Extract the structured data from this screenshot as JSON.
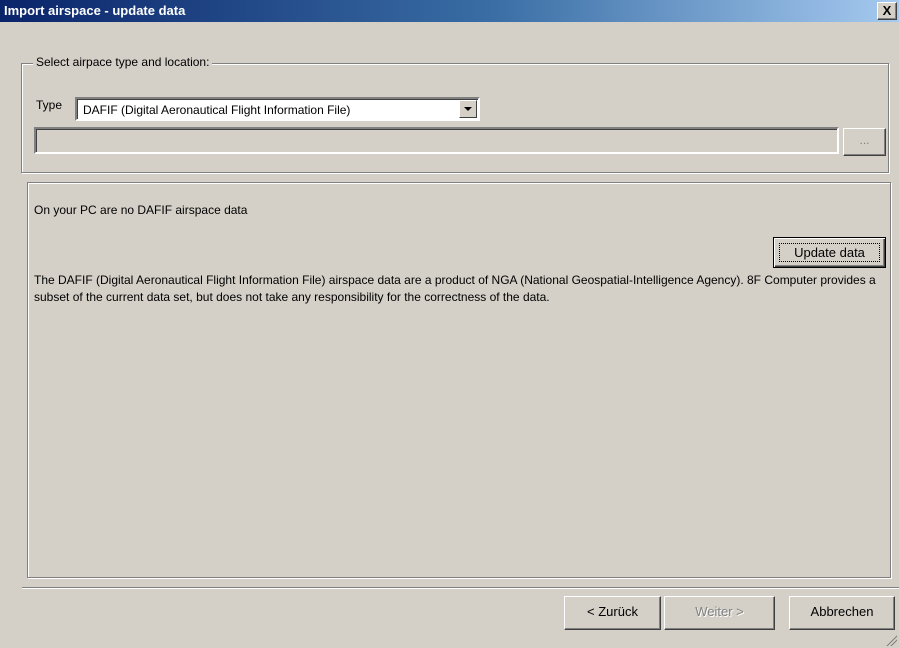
{
  "window": {
    "title": "Import airspace - update data",
    "close_label": "X"
  },
  "location_group": {
    "legend": "Select airpace type and location:",
    "type_label": "Type",
    "type_value": "DAFIF (Digital Aeronautical Flight Information File)",
    "path_value": "",
    "browse_label": "..."
  },
  "info_panel": {
    "status": "On your PC are no DAFIF airspace data",
    "update_button": "Update data",
    "description": "The DAFIF (Digital Aeronautical Flight Information File) airspace data are a product of NGA (National Geospatial-Intelligence Agency). 8F Computer provides a subset of the current data set, but does not take any responsibility for the correctness of the data."
  },
  "footer": {
    "back_button": "< Zurück",
    "next_button": "Weiter >",
    "cancel_button": "Abbrechen"
  },
  "colors": {
    "title_bar": "#0a246a",
    "dialog_face": "#d4d0c8"
  }
}
